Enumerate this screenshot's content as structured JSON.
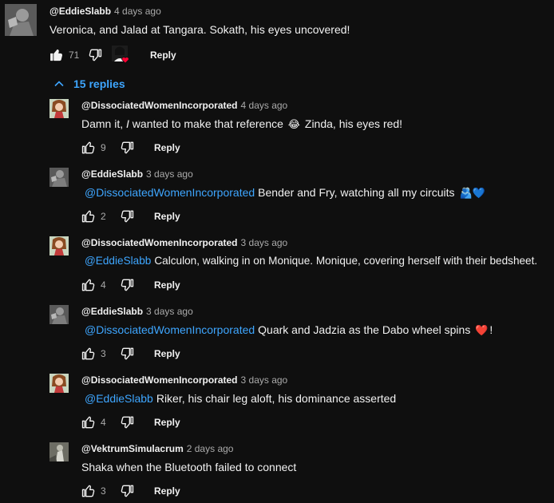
{
  "top_comment": {
    "author": "@EddieSlabb",
    "time": "4 days ago",
    "text": "Veronica, and Jalad at Tangara. Sokath, his eyes uncovered!",
    "likes": "71",
    "reply_label": "Reply",
    "replies_toggle": "15 replies"
  },
  "replies": [
    {
      "author": "@DissociatedWomenIncorporated",
      "time": "4 days ago",
      "text_pre": "Damn it, ",
      "text_italic": "I",
      "text_mid": " wanted to make that reference ",
      "emoji": "😂",
      "text_post": " Zinda, his eyes red!",
      "likes": "9",
      "reply_label": "Reply"
    },
    {
      "author": "@EddieSlabb",
      "time": "3 days ago",
      "mention": "@DissociatedWomenIncorporated",
      "text": "Bender and Fry, watching all my circuits",
      "emoji": "🫂💙",
      "likes": "2",
      "reply_label": "Reply"
    },
    {
      "author": "@DissociatedWomenIncorporated",
      "time": "3 days ago",
      "mention": "@EddieSlabb",
      "text": "Calculon, walking in on Monique. Monique, covering herself with their bedsheet.",
      "likes": "4",
      "reply_label": "Reply"
    },
    {
      "author": "@EddieSlabb",
      "time": "3 days ago",
      "mention": "@DissociatedWomenIncorporated",
      "text": "Quark and Jadzia as the Dabo wheel spins",
      "emoji": "❤️",
      "text_post": "!",
      "likes": "3",
      "reply_label": "Reply"
    },
    {
      "author": "@DissociatedWomenIncorporated",
      "time": "3 days ago",
      "mention": "@EddieSlabb",
      "text": "Riker, his chair leg aloft, his dominance asserted",
      "likes": "4",
      "reply_label": "Reply"
    },
    {
      "author": "@VektrumSimulacrum",
      "time": "2 days ago",
      "text": "Shaka when the Bluetooth failed to connect",
      "likes": "3",
      "reply_label": "Reply"
    }
  ],
  "colors": {
    "background": "#0f0f0f",
    "text": "#f1f1f1",
    "secondary": "#aaaaaa",
    "link": "#3ea6ff",
    "heart": "#ff0033"
  },
  "icons": {
    "like": "thumbs-up-icon",
    "dislike": "thumbs-down-icon",
    "creator_heart": "creator-heart-icon",
    "collapse": "chevron-up-icon"
  }
}
